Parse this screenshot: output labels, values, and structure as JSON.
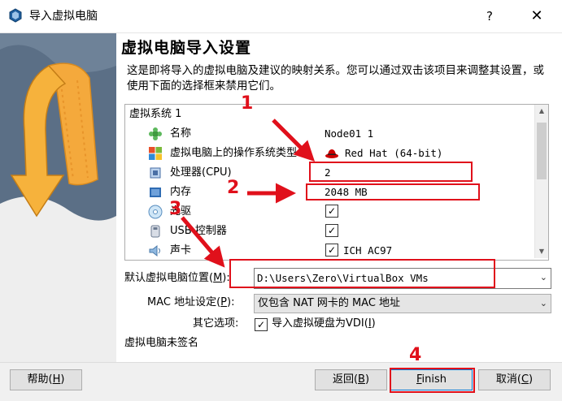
{
  "window": {
    "title": "导入虚拟电脑",
    "help_button": "?",
    "close_button": "✕"
  },
  "page": {
    "heading": "虚拟电脑导入设置",
    "description": "这是即将导入的虚拟电脑及建议的映射关系。您可以通过双击该项目来调整其设置，或使用下面的选择框来禁用它们。"
  },
  "tree": {
    "header": "虚拟系统 1",
    "rows": [
      {
        "icon": "name-puzzle-icon",
        "label": "名称",
        "value": "Node01 1"
      },
      {
        "icon": "os-windows-icon",
        "label": "虚拟电脑上的操作系统类型",
        "value": "Red Hat (64-bit)",
        "value_icon": "redhat-icon"
      },
      {
        "icon": "cpu-chip-icon",
        "label": "处理器(CPU)",
        "value": "2"
      },
      {
        "icon": "memory-chip-icon",
        "label": "内存",
        "value": "2048 MB"
      },
      {
        "icon": "optical-disc-icon",
        "label": "光驱",
        "checked": true
      },
      {
        "icon": "usb-icon",
        "label": "USB 控制器",
        "checked": true
      },
      {
        "icon": "speaker-icon",
        "label": "声卡",
        "checked": true,
        "value": "ICH AC97"
      }
    ]
  },
  "form": {
    "location_label_pre": "默认虚拟电脑位置(",
    "location_label_key": "M",
    "location_label_post": "):",
    "location_value": "D:\\Users\\Zero\\VirtualBox VMs",
    "mac_label_pre": "MAC 地址设定(",
    "mac_label_key": "P",
    "mac_label_post": "):",
    "mac_value": "仅包含 NAT 网卡的 MAC 地址",
    "other_label": "其它选项:",
    "vdi_label_pre": "导入虚拟硬盘为VDI(",
    "vdi_label_key": "I",
    "vdi_label_post": ")",
    "vdi_checked": true,
    "unsigned_text": "虚拟电脑未签名"
  },
  "buttons": {
    "help_pre": "帮助(",
    "help_key": "H",
    "help_post": ")",
    "back_pre": "返回(",
    "back_key": "B",
    "back_post": ")",
    "finish_key": "F",
    "finish_rest": "inish",
    "cancel_pre": "取消(",
    "cancel_key": "C",
    "cancel_post": ")"
  },
  "annotations": {
    "n1": "1",
    "n2": "2",
    "n3": "3",
    "n4": "4",
    "color": "#e0101b"
  },
  "colors": {
    "accent": "#0078d7",
    "annotation_red": "#e0101b",
    "banner_blue": "#5b6f86",
    "banner_orange": "#f4a93c"
  }
}
